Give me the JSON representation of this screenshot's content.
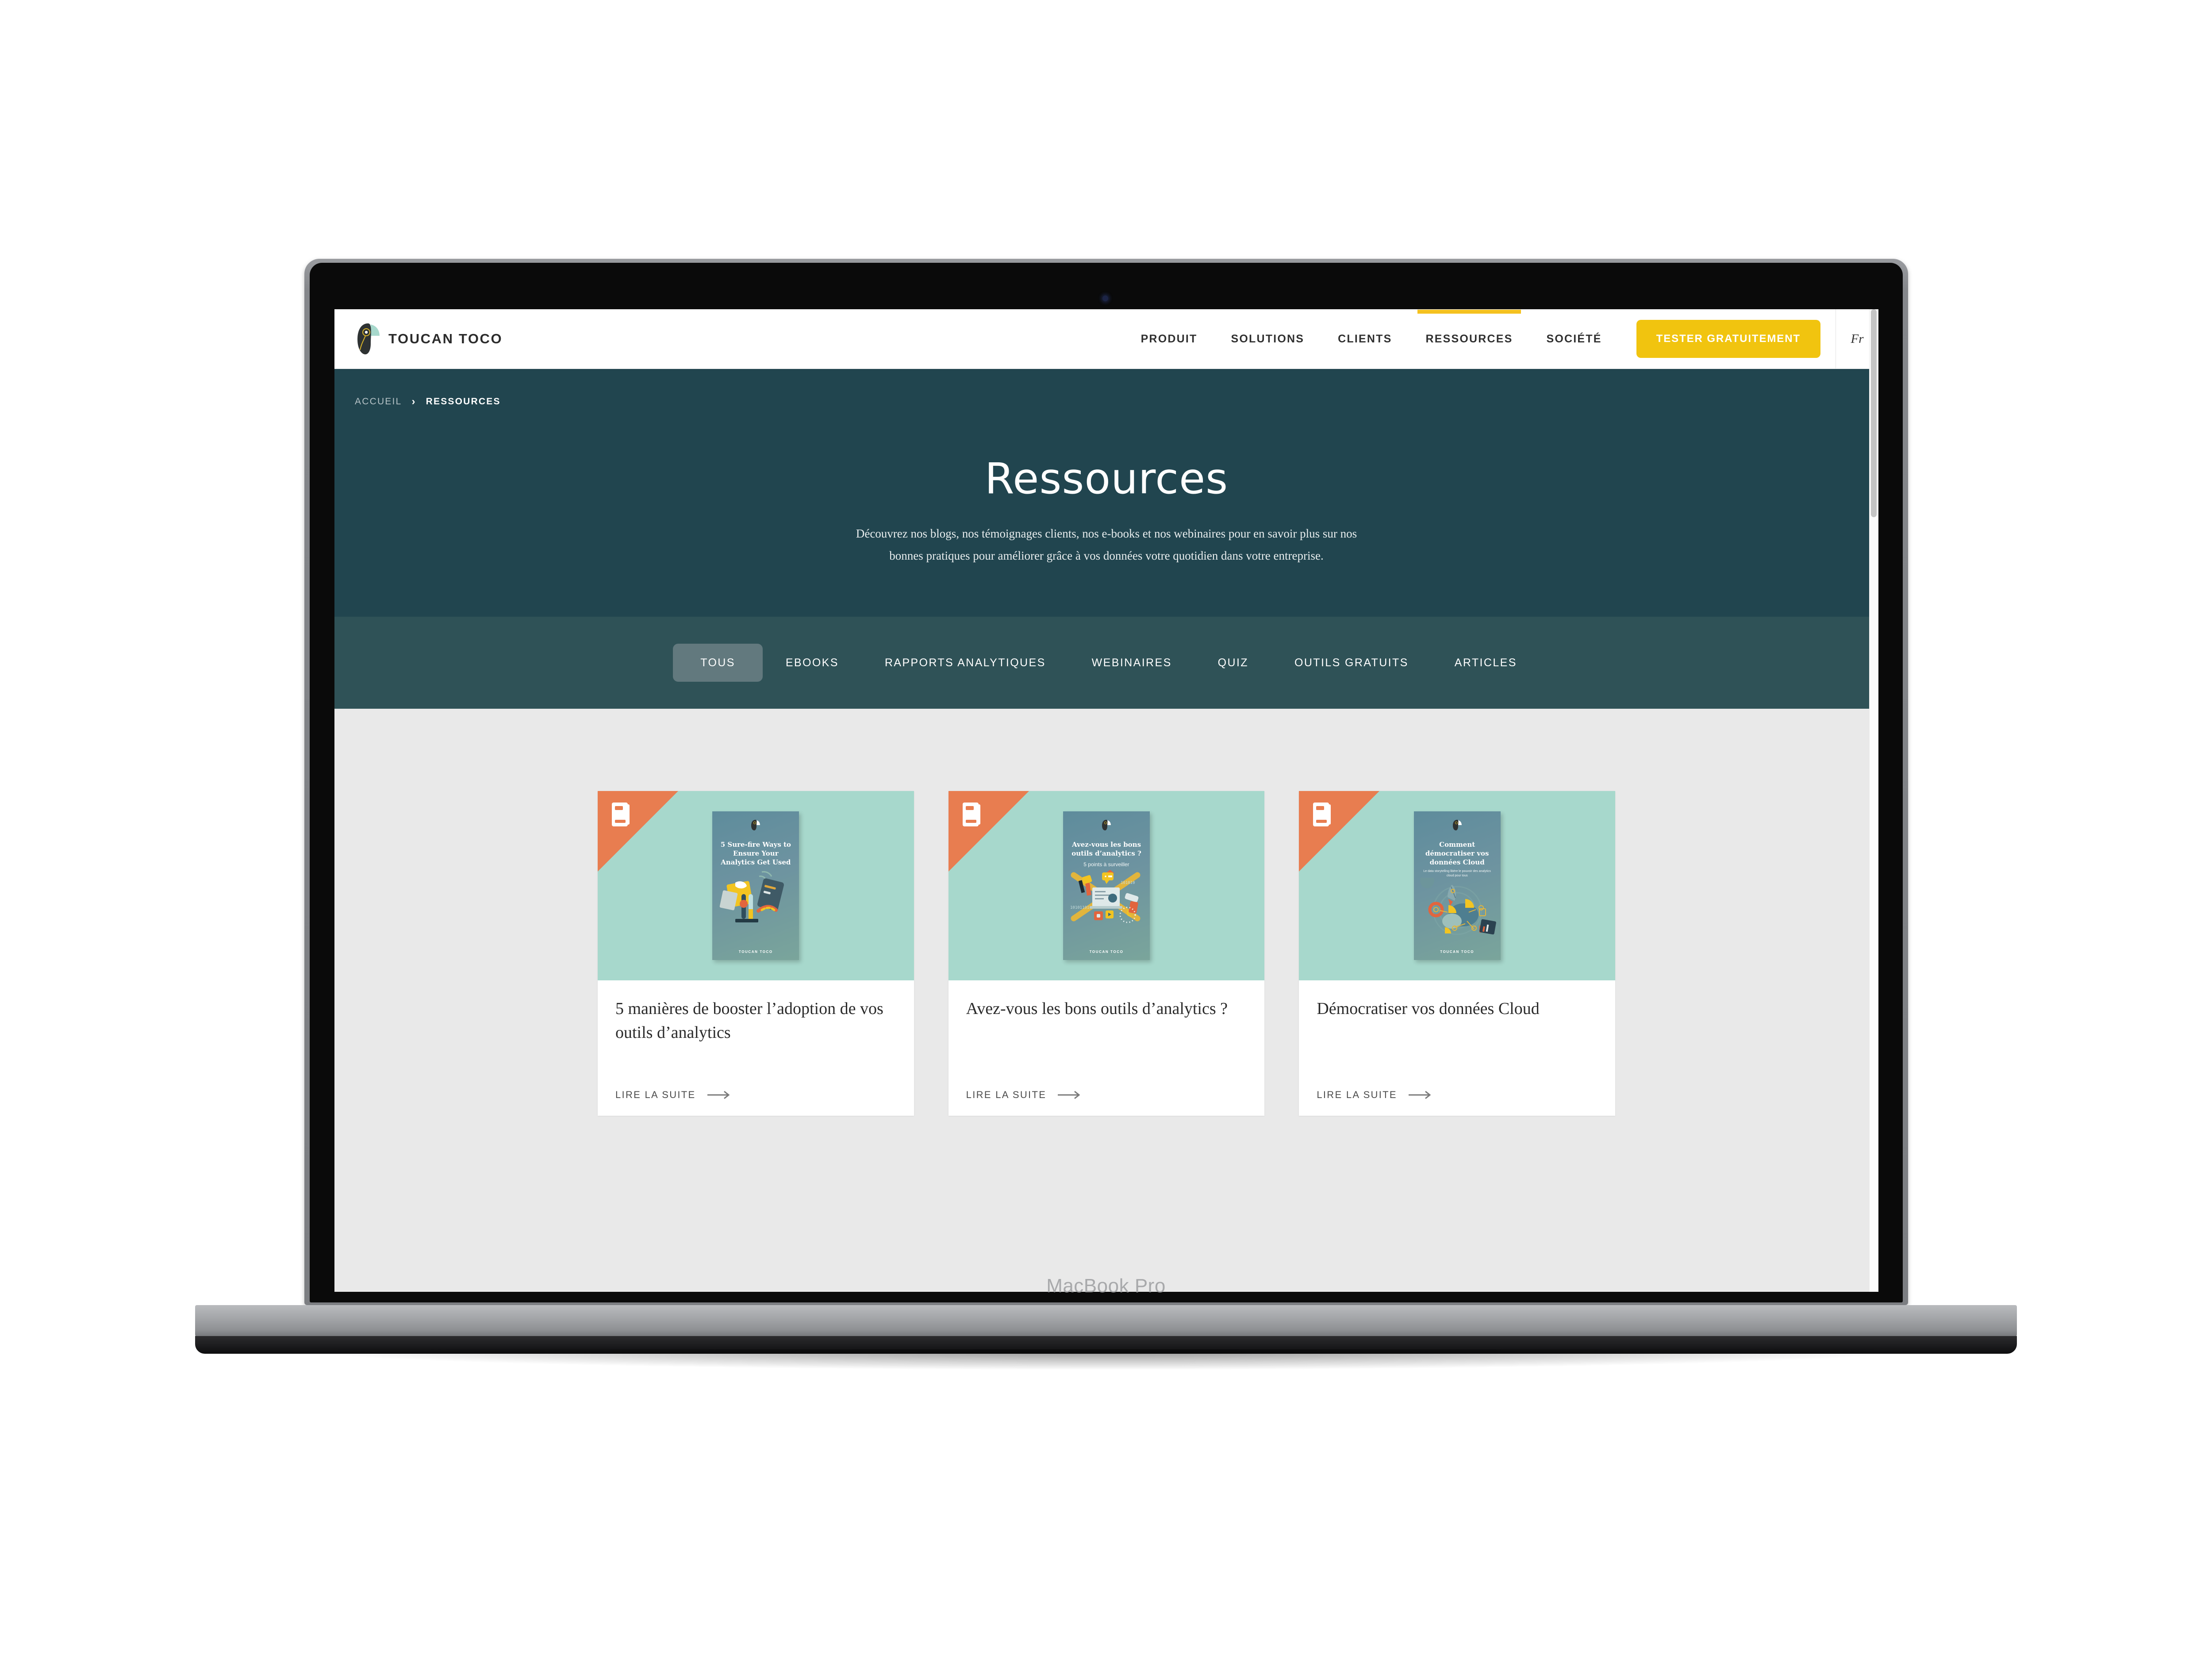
{
  "device": {
    "label": "MacBook Pro",
    "camera_icon": "camera-dot"
  },
  "colors": {
    "brand_yellow": "#F1C40F",
    "hero_teal": "#21454F",
    "filter_teal": "#2F5257",
    "filter_active": "#62797E",
    "page_grey": "#E9E9E9",
    "card_mint": "#A7D8CC",
    "badge_orange": "#E87D50"
  },
  "navbar": {
    "logo_text": "TOUCAN TOCO",
    "logo_icon": "toucan-logo-icon",
    "links": [
      {
        "label": "PRODUIT",
        "active": false
      },
      {
        "label": "SOLUTIONS",
        "active": false
      },
      {
        "label": "CLIENTS",
        "active": false
      },
      {
        "label": "RESSOURCES",
        "active": true
      },
      {
        "label": "SOCIÉTÉ",
        "active": false
      }
    ],
    "cta_label": "TESTER GRATUITEMENT",
    "language": "Fr"
  },
  "hero": {
    "breadcrumb": {
      "home": "ACCUEIL",
      "separator": "›",
      "current": "RESSOURCES"
    },
    "title": "Ressources",
    "subtitle": "Découvrez nos blogs, nos témoignages clients, nos e-books et nos webinaires pour en savoir plus sur nos bonnes pratiques pour améliorer grâce à vos données votre quotidien dans votre entreprise."
  },
  "filters": [
    {
      "label": "TOUS",
      "active": true
    },
    {
      "label": "EBOOKS",
      "active": false
    },
    {
      "label": "RAPPORTS ANALYTIQUES",
      "active": false
    },
    {
      "label": "WEBINAIRES",
      "active": false
    },
    {
      "label": "QUIZ",
      "active": false
    },
    {
      "label": "OUTILS GRATUITS",
      "active": false
    },
    {
      "label": "ARTICLES",
      "active": false
    }
  ],
  "cards": [
    {
      "badge_icon": "ebook-icon",
      "cover_title": "5 Sure-fire Ways to Ensure Your Analytics Get Used",
      "cover_subtitle": "",
      "cover_brand": "TOUCAN TOCO",
      "title": "5 manières de booster l’adoption de vos outils d’analytics",
      "cta": "LIRE LA SUITE",
      "cta_icon": "arrow-right-icon"
    },
    {
      "badge_icon": "ebook-icon",
      "cover_title": "Avez-vous les bons outils d’analytics ?",
      "cover_subtitle": "5 points à surveiller",
      "cover_brand": "TOUCAN TOCO",
      "title": "Avez-vous les bons outils d’analytics ?",
      "cta": "LIRE LA SUITE",
      "cta_icon": "arrow-right-icon"
    },
    {
      "badge_icon": "ebook-icon",
      "cover_title": "Comment démocratiser vos données Cloud",
      "cover_subtitle": "Le data storytelling libère le pouvoir des analytics cloud pour tous",
      "cover_brand": "TOUCAN TOCO",
      "title": "Démocratiser vos données Cloud",
      "cta": "LIRE LA SUITE",
      "cta_icon": "arrow-right-icon"
    }
  ],
  "scrollbar": {
    "name": "vertical-scrollbar"
  }
}
